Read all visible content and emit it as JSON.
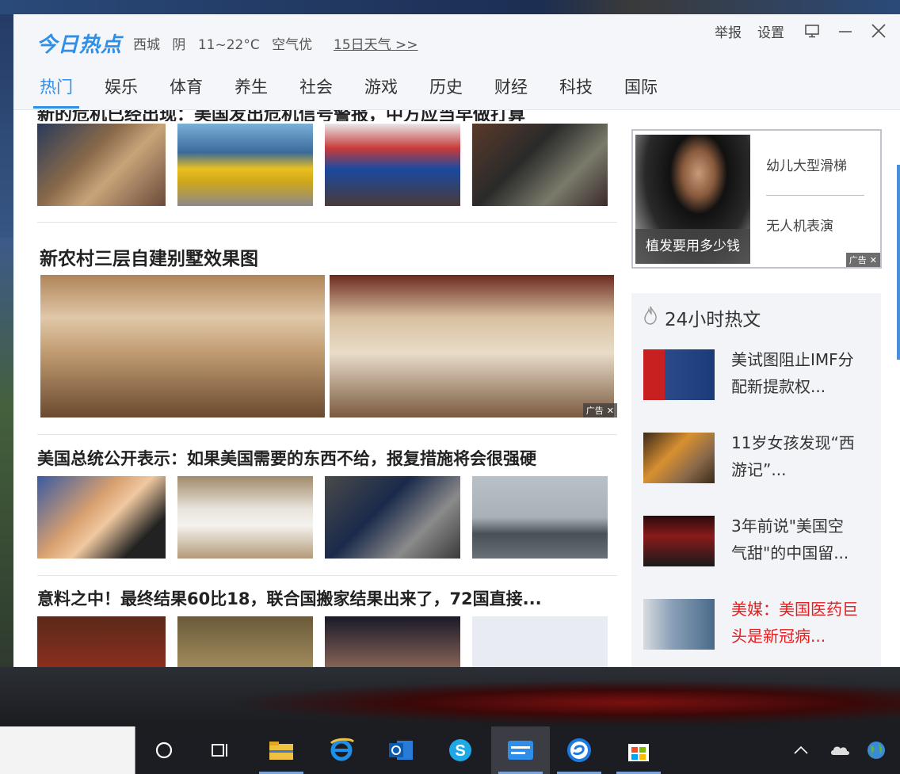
{
  "app": {
    "logo": "今日热点",
    "weather": {
      "city": "西城",
      "condition": "阴",
      "temp": "11~22°C",
      "air": "空气优"
    },
    "forecast_link": "15日天气 >>",
    "controls": {
      "report": "举报",
      "settings": "设置"
    }
  },
  "tabs": [
    "热门",
    "娱乐",
    "体育",
    "养生",
    "社会",
    "游戏",
    "历史",
    "财经",
    "科技",
    "国际"
  ],
  "feed": {
    "item1_title": "新的危机已经出现：美国发出危机信号警报，中方应当早做打算",
    "ad_title": "新农村三层自建别墅效果图",
    "ad_label": "广告",
    "item2_title": "美国总统公开表示：如果美国需要的东西不给，报复措施将会很强硬",
    "item3_title": "意料之中！最终结果60比18，联合国搬家结果出来了，72国直接..."
  },
  "side_ad": {
    "caption": "植发要用多少钱",
    "link1": "幼儿大型滑梯",
    "link2": "无人机表演",
    "ad_label": "广告"
  },
  "hot": {
    "title": "24小时热文",
    "items": [
      {
        "title": "美试图阻止IMF分配新提款权...",
        "highlight": false
      },
      {
        "title": "11岁女孩发现“西游记”...",
        "highlight": false
      },
      {
        "title": "3年前说\"美国空气甜\"的中国留...",
        "highlight": false
      },
      {
        "title": "美媒：美国医药巨头是新冠病...",
        "highlight": true
      }
    ]
  },
  "colors": {
    "accent": "#2f8ee8",
    "highlight": "#e02020"
  }
}
